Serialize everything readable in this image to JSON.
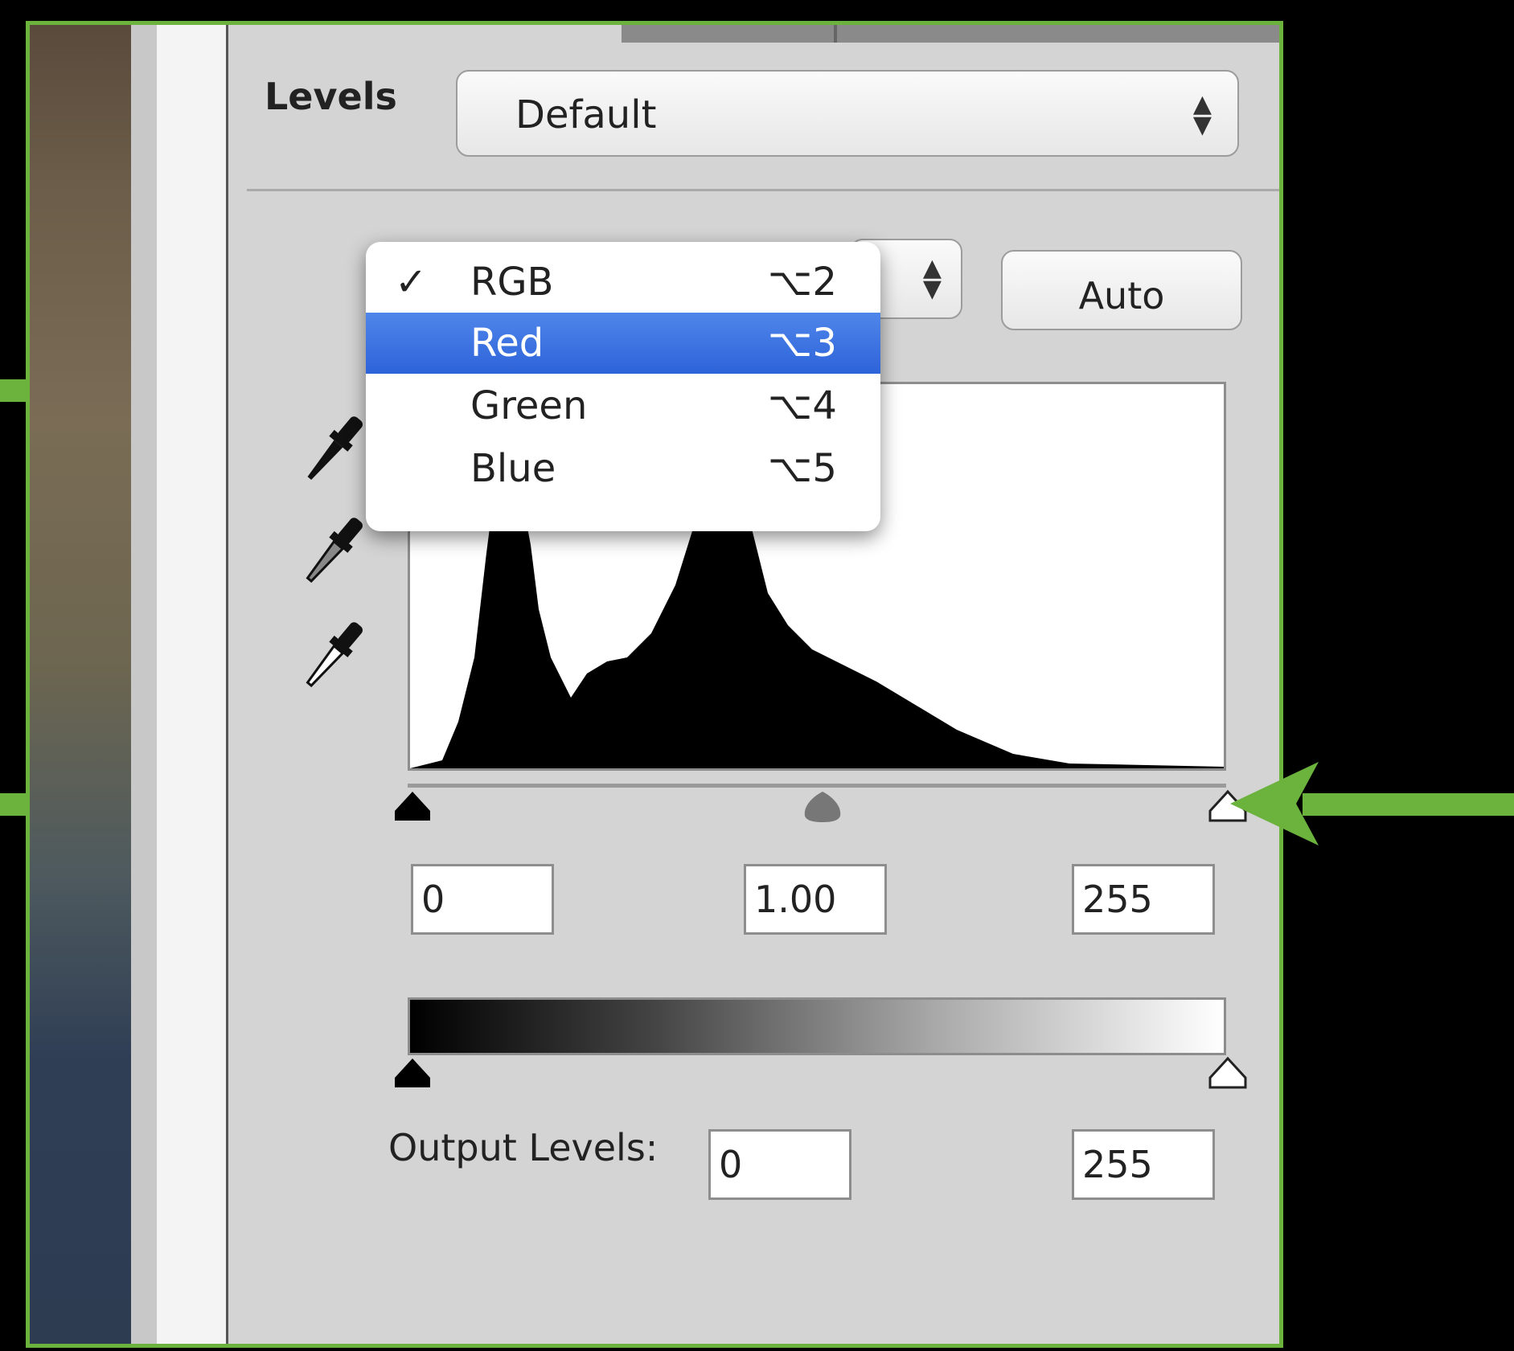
{
  "panel": {
    "preset_label": "Levels",
    "preset_value": "Default",
    "auto_button": "Auto",
    "output_label": "Output Levels:"
  },
  "channel_menu": {
    "items": [
      {
        "label": "RGB",
        "shortcut": "⌥2",
        "checked": true,
        "highlighted": false
      },
      {
        "label": "Red",
        "shortcut": "⌥3",
        "checked": false,
        "highlighted": true
      },
      {
        "label": "Green",
        "shortcut": "⌥4",
        "checked": false,
        "highlighted": false
      },
      {
        "label": "Blue",
        "shortcut": "⌥5",
        "checked": false,
        "highlighted": false
      }
    ],
    "check_glyph": "✓"
  },
  "input_levels": {
    "black": "0",
    "gamma": "1.00",
    "white": "255"
  },
  "output_levels": {
    "black": "0",
    "white": "255"
  },
  "icons": {
    "eyedroppers": [
      "black-point-eyedropper-icon",
      "gray-point-eyedropper-icon",
      "white-point-eyedropper-icon"
    ],
    "sliders": [
      "black-input-slider-icon",
      "gamma-slider-icon",
      "white-input-slider-icon",
      "black-output-slider-icon",
      "white-output-slider-icon"
    ]
  },
  "colors": {
    "annotation": "#6cb33e",
    "highlight": "#2d63d9",
    "panel": "#d4d4d4"
  }
}
